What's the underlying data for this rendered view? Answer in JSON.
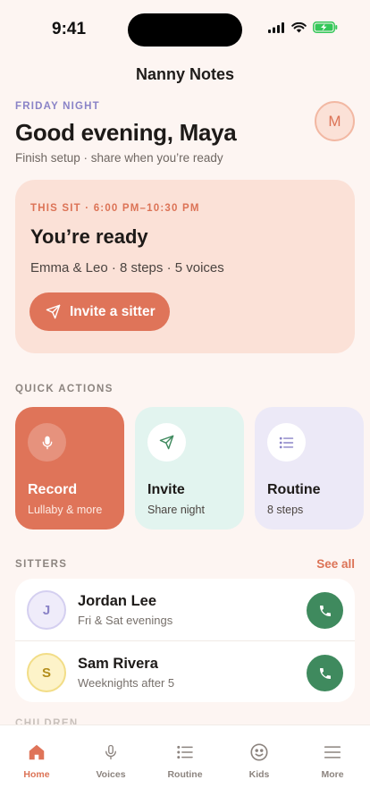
{
  "status": {
    "time": "9:41"
  },
  "header": {
    "title": "Nanny Notes"
  },
  "greeting": {
    "eyebrow": "FRIDAY NIGHT",
    "title": "Good evening, Maya",
    "subtitle": "Finish setup · share when you’re ready",
    "avatar_initial": "M"
  },
  "sit": {
    "eyebrow": "THIS SIT · 6:00 PM–10:30 PM",
    "title": "You’re ready",
    "meta": "Emma & Leo · 8 steps · 5 voices",
    "invite_label": "Invite a sitter"
  },
  "quick_actions": {
    "label": "QUICK ACTIONS",
    "items": [
      {
        "title": "Record",
        "subtitle": "Lullaby & more",
        "icon": "mic-icon"
      },
      {
        "title": "Invite",
        "subtitle": "Share night",
        "icon": "send-icon"
      },
      {
        "title": "Routine",
        "subtitle": "8 steps",
        "icon": "list-icon"
      }
    ]
  },
  "sitters": {
    "label": "SITTERS",
    "see_all": "See all",
    "items": [
      {
        "initial": "J",
        "name": "Jordan Lee",
        "schedule": "Fri & Sat evenings"
      },
      {
        "initial": "S",
        "name": "Sam Rivera",
        "schedule": "Weeknights after 5"
      }
    ]
  },
  "children": {
    "label": "CHILDREN"
  },
  "tabs": [
    {
      "label": "Home",
      "icon": "home-icon"
    },
    {
      "label": "Voices",
      "icon": "mic-icon"
    },
    {
      "label": "Routine",
      "icon": "list-icon"
    },
    {
      "label": "Kids",
      "icon": "smile-icon"
    },
    {
      "label": "More",
      "icon": "menu-icon"
    }
  ],
  "colors": {
    "background": "#fdf5f2",
    "accent": "#df7459",
    "success": "#3f8a5e",
    "lavender": "#8a83c7"
  }
}
